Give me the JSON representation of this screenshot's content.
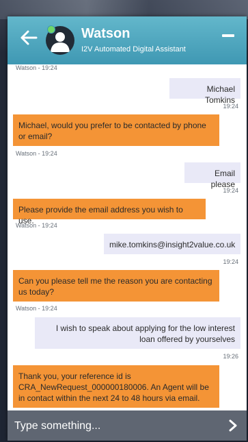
{
  "header": {
    "name": "Watson",
    "subtitle": "I2V Automated Digital Assistant",
    "back_icon": "arrow-left-icon",
    "minimize_icon": "minimize-icon",
    "presence_color": "#6fd66a"
  },
  "messages": [
    {
      "sender": "Watson",
      "meta": "Watson - 19:24",
      "text": "",
      "kind": "meta-only"
    },
    {
      "sender": "user",
      "text": "Michael Tomkins",
      "time": "19:24"
    },
    {
      "sender": "bot",
      "text": "Michael, would you prefer to be contacted by phone or email?",
      "meta": "Watson - 19:24"
    },
    {
      "sender": "user",
      "text": "Email please",
      "time": "19:24"
    },
    {
      "sender": "bot",
      "text": "Please provide the email address you wish to use.",
      "meta": "Watson - 19:24"
    },
    {
      "sender": "user",
      "text": "mike.tomkins@insight2value.co.uk",
      "time": "19:24"
    },
    {
      "sender": "bot",
      "text": "Can you please tell me the reason you are contacting us today?",
      "meta": "Watson - 19:24"
    },
    {
      "sender": "user",
      "text": "I wish to speak about applying for the low interest loan offered by yourselves",
      "time": "19:26"
    },
    {
      "sender": "bot",
      "text": "Thank you, your reference id is CRA_NewRequest_000000180006. An Agent will be in contact within the next 24 to 48 hours via email.",
      "meta": ""
    }
  ],
  "input": {
    "placeholder": "Type something...",
    "send_icon": "chevron-right-icon"
  },
  "colors": {
    "header": "#4aa6bf",
    "bot_bubble": "#f49436",
    "user_bubble": "#e9e9f7",
    "input_bar": "#5f6672"
  }
}
